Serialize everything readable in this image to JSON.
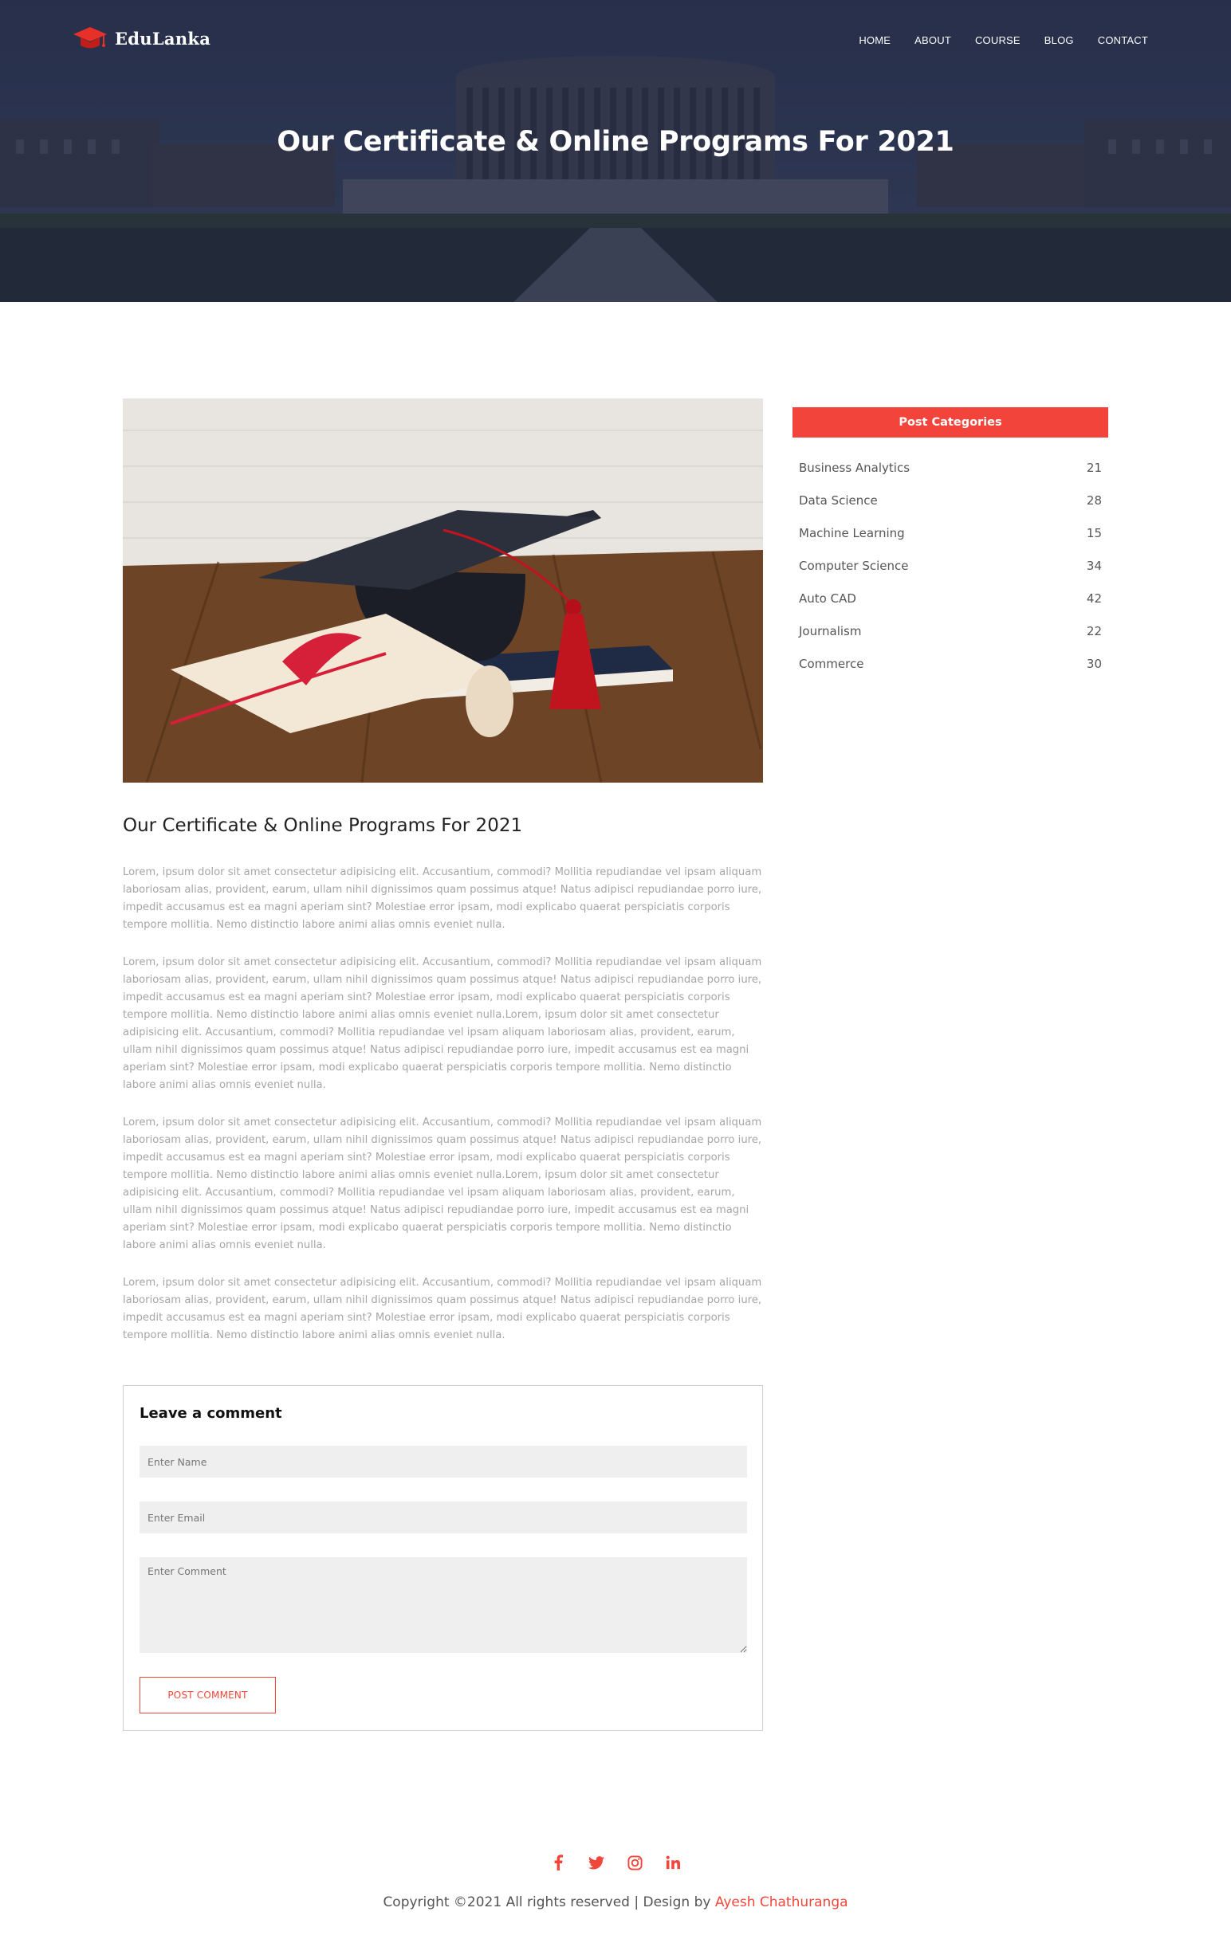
{
  "brand": {
    "name": "EduLanka",
    "accent": "#f0473a"
  },
  "nav": [
    "HOME",
    "ABOUT",
    "COURSE",
    "BLOG",
    "CONTACT"
  ],
  "hero": {
    "title": "Our Certificate & Online Programs For 2021"
  },
  "article": {
    "title": "Our Certificate & Online Programs For 2021",
    "paragraphs": [
      "Lorem, ipsum dolor sit amet consectetur adipisicing elit. Accusantium, commodi? Mollitia repudiandae vel ipsam aliquam laboriosam alias, provident, earum, ullam nihil dignissimos quam possimus atque! Natus adipisci repudiandae porro iure, impedit accusamus est ea magni aperiam sint? Molestiae error ipsam, modi explicabo quaerat perspiciatis corporis tempore mollitia. Nemo distinctio labore animi alias omnis eveniet nulla.",
      "Lorem, ipsum dolor sit amet consectetur adipisicing elit. Accusantium, commodi? Mollitia repudiandae vel ipsam aliquam laboriosam alias, provident, earum, ullam nihil dignissimos quam possimus atque! Natus adipisci repudiandae porro iure, impedit accusamus est ea magni aperiam sint? Molestiae error ipsam, modi explicabo quaerat perspiciatis corporis tempore mollitia. Nemo distinctio labore animi alias omnis eveniet nulla.Lorem, ipsum dolor sit amet consectetur adipisicing elit. Accusantium, commodi? Mollitia repudiandae vel ipsam aliquam laboriosam alias, provident, earum, ullam nihil dignissimos quam possimus atque! Natus adipisci repudiandae porro iure, impedit accusamus est ea magni aperiam sint? Molestiae error ipsam, modi explicabo quaerat perspiciatis corporis tempore mollitia. Nemo distinctio labore animi alias omnis eveniet nulla.",
      "Lorem, ipsum dolor sit amet consectetur adipisicing elit. Accusantium, commodi? Mollitia repudiandae vel ipsam aliquam laboriosam alias, provident, earum, ullam nihil dignissimos quam possimus atque! Natus adipisci repudiandae porro iure, impedit accusamus est ea magni aperiam sint? Molestiae error ipsam, modi explicabo quaerat perspiciatis corporis tempore mollitia. Nemo distinctio labore animi alias omnis eveniet nulla.Lorem, ipsum dolor sit amet consectetur adipisicing elit. Accusantium, commodi? Mollitia repudiandae vel ipsam aliquam laboriosam alias, provident, earum, ullam nihil dignissimos quam possimus atque! Natus adipisci repudiandae porro iure, impedit accusamus est ea magni aperiam sint? Molestiae error ipsam, modi explicabo quaerat perspiciatis corporis tempore mollitia. Nemo distinctio labore animi alias omnis eveniet nulla.",
      "Lorem, ipsum dolor sit amet consectetur adipisicing elit. Accusantium, commodi? Mollitia repudiandae vel ipsam aliquam laboriosam alias, provident, earum, ullam nihil dignissimos quam possimus atque! Natus adipisci repudiandae porro iure, impedit accusamus est ea magni aperiam sint? Molestiae error ipsam, modi explicabo quaerat perspiciatis corporis tempore mollitia. Nemo distinctio labore animi alias omnis eveniet nulla."
    ]
  },
  "comment_form": {
    "title": "Leave a comment",
    "name_placeholder": "Enter Name",
    "email_placeholder": "Enter Email",
    "comment_placeholder": "Enter Comment",
    "submit_label": "POST COMMENT"
  },
  "sidebar": {
    "title": "Post Categories",
    "categories": [
      {
        "label": "Business Analytics",
        "count": "21"
      },
      {
        "label": "Data Science",
        "count": "28"
      },
      {
        "label": "Machine Learning",
        "count": "15"
      },
      {
        "label": "Computer Science",
        "count": "34"
      },
      {
        "label": "Auto CAD",
        "count": "42"
      },
      {
        "label": "Journalism",
        "count": "22"
      },
      {
        "label": "Commerce",
        "count": "30"
      }
    ]
  },
  "footer": {
    "social_icons": [
      "facebook-icon",
      "twitter-icon",
      "instagram-icon",
      "linkedin-icon"
    ],
    "copyright_text": "Copyright ©2021 All rights reserved | Design by",
    "designer": "Ayesh Chathuranga"
  }
}
